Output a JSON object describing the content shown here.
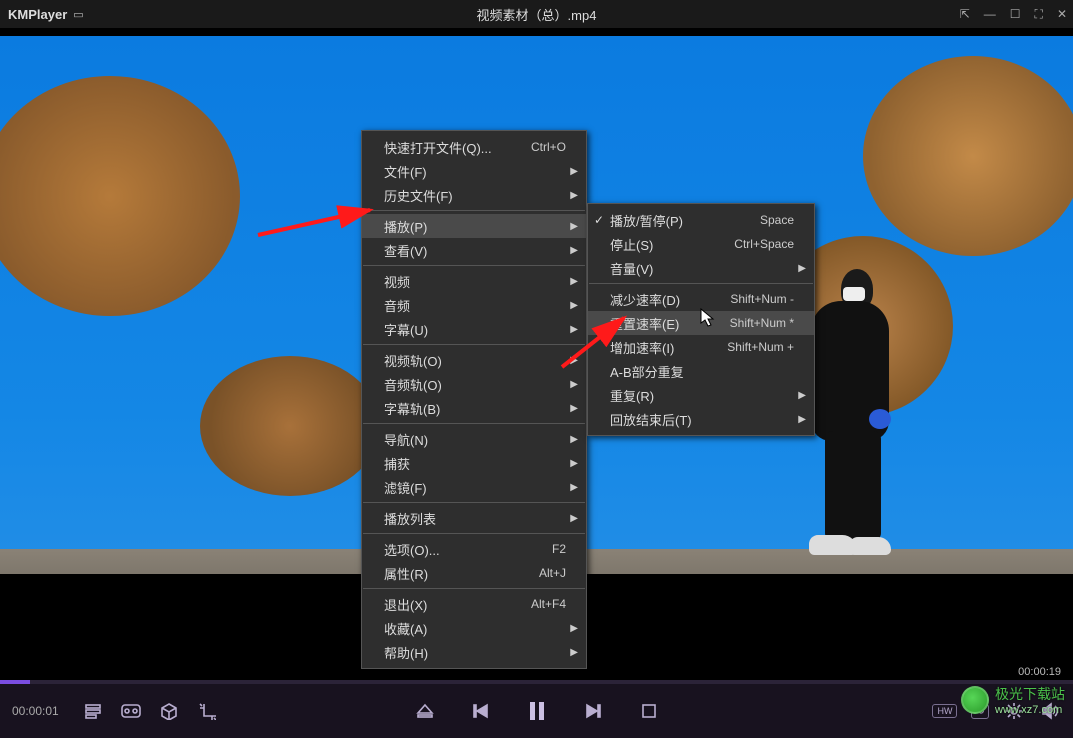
{
  "titlebar": {
    "app_name": "KMPlayer",
    "file_title": "视频素材（总）.mp4"
  },
  "menu_primary": [
    {
      "label": "快速打开文件(Q)...",
      "shortcut": "Ctrl+O",
      "arrow": false
    },
    {
      "label": "文件(F)",
      "arrow": true
    },
    {
      "label": "历史文件(F)",
      "arrow": true
    },
    {
      "sep": true
    },
    {
      "label": "播放(P)",
      "arrow": true,
      "highlight": true
    },
    {
      "label": "查看(V)",
      "arrow": true
    },
    {
      "sep": true
    },
    {
      "label": "视频",
      "arrow": true
    },
    {
      "label": "音频",
      "arrow": true
    },
    {
      "label": "字幕(U)",
      "arrow": true
    },
    {
      "sep": true
    },
    {
      "label": "视频轨(O)",
      "arrow": true
    },
    {
      "label": "音频轨(O)",
      "arrow": true
    },
    {
      "label": "字幕轨(B)",
      "arrow": true
    },
    {
      "sep": true
    },
    {
      "label": "导航(N)",
      "arrow": true
    },
    {
      "label": "捕获",
      "arrow": true
    },
    {
      "label": "滤镜(F)",
      "arrow": true
    },
    {
      "sep": true
    },
    {
      "label": "播放列表",
      "arrow": true
    },
    {
      "sep": true
    },
    {
      "label": "选项(O)...",
      "shortcut": "F2"
    },
    {
      "label": "属性(R)",
      "shortcut": "Alt+J"
    },
    {
      "sep": true
    },
    {
      "label": "退出(X)",
      "shortcut": "Alt+F4"
    },
    {
      "label": "收藏(A)",
      "arrow": true
    },
    {
      "label": "帮助(H)",
      "arrow": true
    }
  ],
  "menu_secondary": [
    {
      "label": "播放/暂停(P)",
      "shortcut": "Space",
      "check": true
    },
    {
      "label": "停止(S)",
      "shortcut": "Ctrl+Space"
    },
    {
      "label": "音量(V)",
      "arrow": true
    },
    {
      "sep": true
    },
    {
      "label": "减少速率(D)",
      "shortcut": "Shift+Num -"
    },
    {
      "label": "重置速率(E)",
      "shortcut": "Shift+Num *",
      "highlight": true
    },
    {
      "label": "增加速率(I)",
      "shortcut": "Shift+Num +"
    },
    {
      "label": "A-B部分重复"
    },
    {
      "label": "重复(R)",
      "arrow": true
    },
    {
      "label": "回放结束后(T)",
      "arrow": true
    }
  ],
  "playback": {
    "current_time": "00:00:01",
    "duration": "00:00:19",
    "hw_badge": "HW",
    "rot_badge": "⟲"
  },
  "watermark": {
    "title": "极光下载站",
    "sub": "www.xz7.com"
  }
}
